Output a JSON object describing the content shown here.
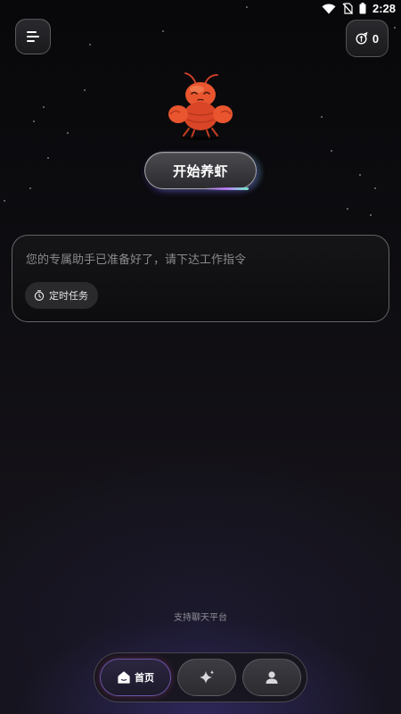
{
  "status_bar": {
    "time": "2:28",
    "icons": [
      "wifi-icon",
      "no-sim-icon",
      "battery-icon"
    ]
  },
  "header": {
    "menu_icon": "menu-icon",
    "coin_icon": "coin-icon",
    "coin_count": "0"
  },
  "mascot": {
    "icon": "lobster-mascot"
  },
  "start_button": {
    "label": "开始养虾"
  },
  "prompt": {
    "placeholder": "您的专属助手已准备好了，请下达工作指令",
    "task_chip_label": "定时任务",
    "task_chip_icon": "timer-icon"
  },
  "footer": {
    "platform_text": "支持聊天平台"
  },
  "tabs": [
    {
      "label": "首页",
      "icon": "home-icon",
      "active": true
    },
    {
      "label": "",
      "icon": "sparkle-icon",
      "active": false
    },
    {
      "label": "",
      "icon": "user-icon",
      "active": false
    }
  ],
  "colors": {
    "background": "#0d0c10",
    "accent": "#a082ff",
    "mascot": "#e8502e"
  }
}
